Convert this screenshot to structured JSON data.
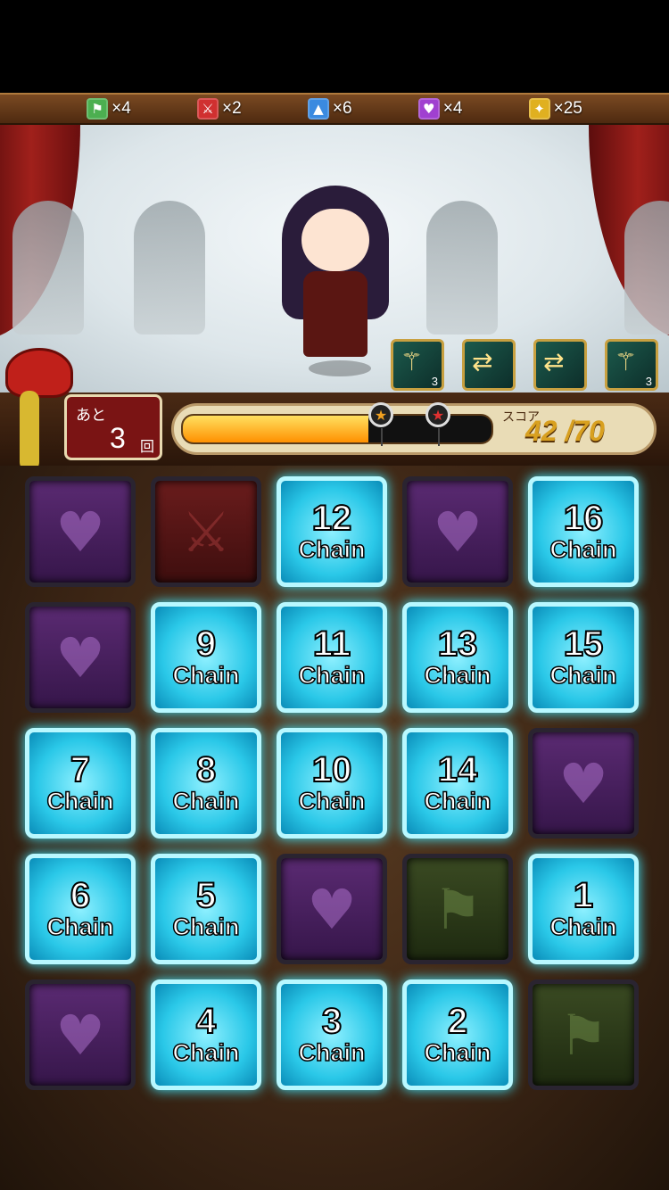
{
  "resources": [
    {
      "icon": "green-gem-icon",
      "color": "#4caf50",
      "glyph": "⚑",
      "count": "×4"
    },
    {
      "icon": "red-sword-gem-icon",
      "color": "#d03030",
      "glyph": "⚔",
      "count": "×2"
    },
    {
      "icon": "blue-gem-icon",
      "color": "#3a8ae0",
      "glyph": "▲",
      "count": "×6"
    },
    {
      "icon": "purple-heart-gem-icon",
      "color": "#a040d0",
      "glyph": "♥",
      "count": "×4"
    },
    {
      "icon": "gold-star-gem-icon",
      "color": "#e0b020",
      "glyph": "✦",
      "count": "×25"
    }
  ],
  "skills": [
    {
      "icon": "wand-skill-icon",
      "level": "3"
    },
    {
      "icon": "convert-skill-icon",
      "level": ""
    },
    {
      "icon": "convert-skill-icon",
      "level": ""
    },
    {
      "icon": "wand-skill-icon",
      "level": "3"
    }
  ],
  "remaining": {
    "prefix": "あと",
    "count": "3",
    "suffix": "回"
  },
  "score": {
    "label": "スコア",
    "value": "42 /70",
    "progress": 0.6
  },
  "milestones": [
    {
      "icon": "gold-star-icon",
      "glyph": "★",
      "color": "#f0a020"
    },
    {
      "icon": "red-star-icon",
      "glyph": "★",
      "color": "#e03030"
    }
  ],
  "board": {
    "chain_word": "Chain",
    "rows": [
      [
        {
          "t": "purple"
        },
        {
          "t": "red"
        },
        {
          "t": "chain",
          "n": "12"
        },
        {
          "t": "purple"
        },
        {
          "t": "chain",
          "n": "16"
        }
      ],
      [
        {
          "t": "purple"
        },
        {
          "t": "chain",
          "n": "9"
        },
        {
          "t": "chain",
          "n": "11"
        },
        {
          "t": "chain",
          "n": "13"
        },
        {
          "t": "chain",
          "n": "15"
        }
      ],
      [
        {
          "t": "chain",
          "n": "7"
        },
        {
          "t": "chain",
          "n": "8"
        },
        {
          "t": "chain",
          "n": "10"
        },
        {
          "t": "chain",
          "n": "14"
        },
        {
          "t": "purple"
        }
      ],
      [
        {
          "t": "chain",
          "n": "6"
        },
        {
          "t": "chain",
          "n": "5"
        },
        {
          "t": "purple"
        },
        {
          "t": "green"
        },
        {
          "t": "chain",
          "n": "1"
        }
      ],
      [
        {
          "t": "purple"
        },
        {
          "t": "chain",
          "n": "4"
        },
        {
          "t": "chain",
          "n": "3"
        },
        {
          "t": "chain",
          "n": "2"
        },
        {
          "t": "green"
        }
      ]
    ]
  }
}
